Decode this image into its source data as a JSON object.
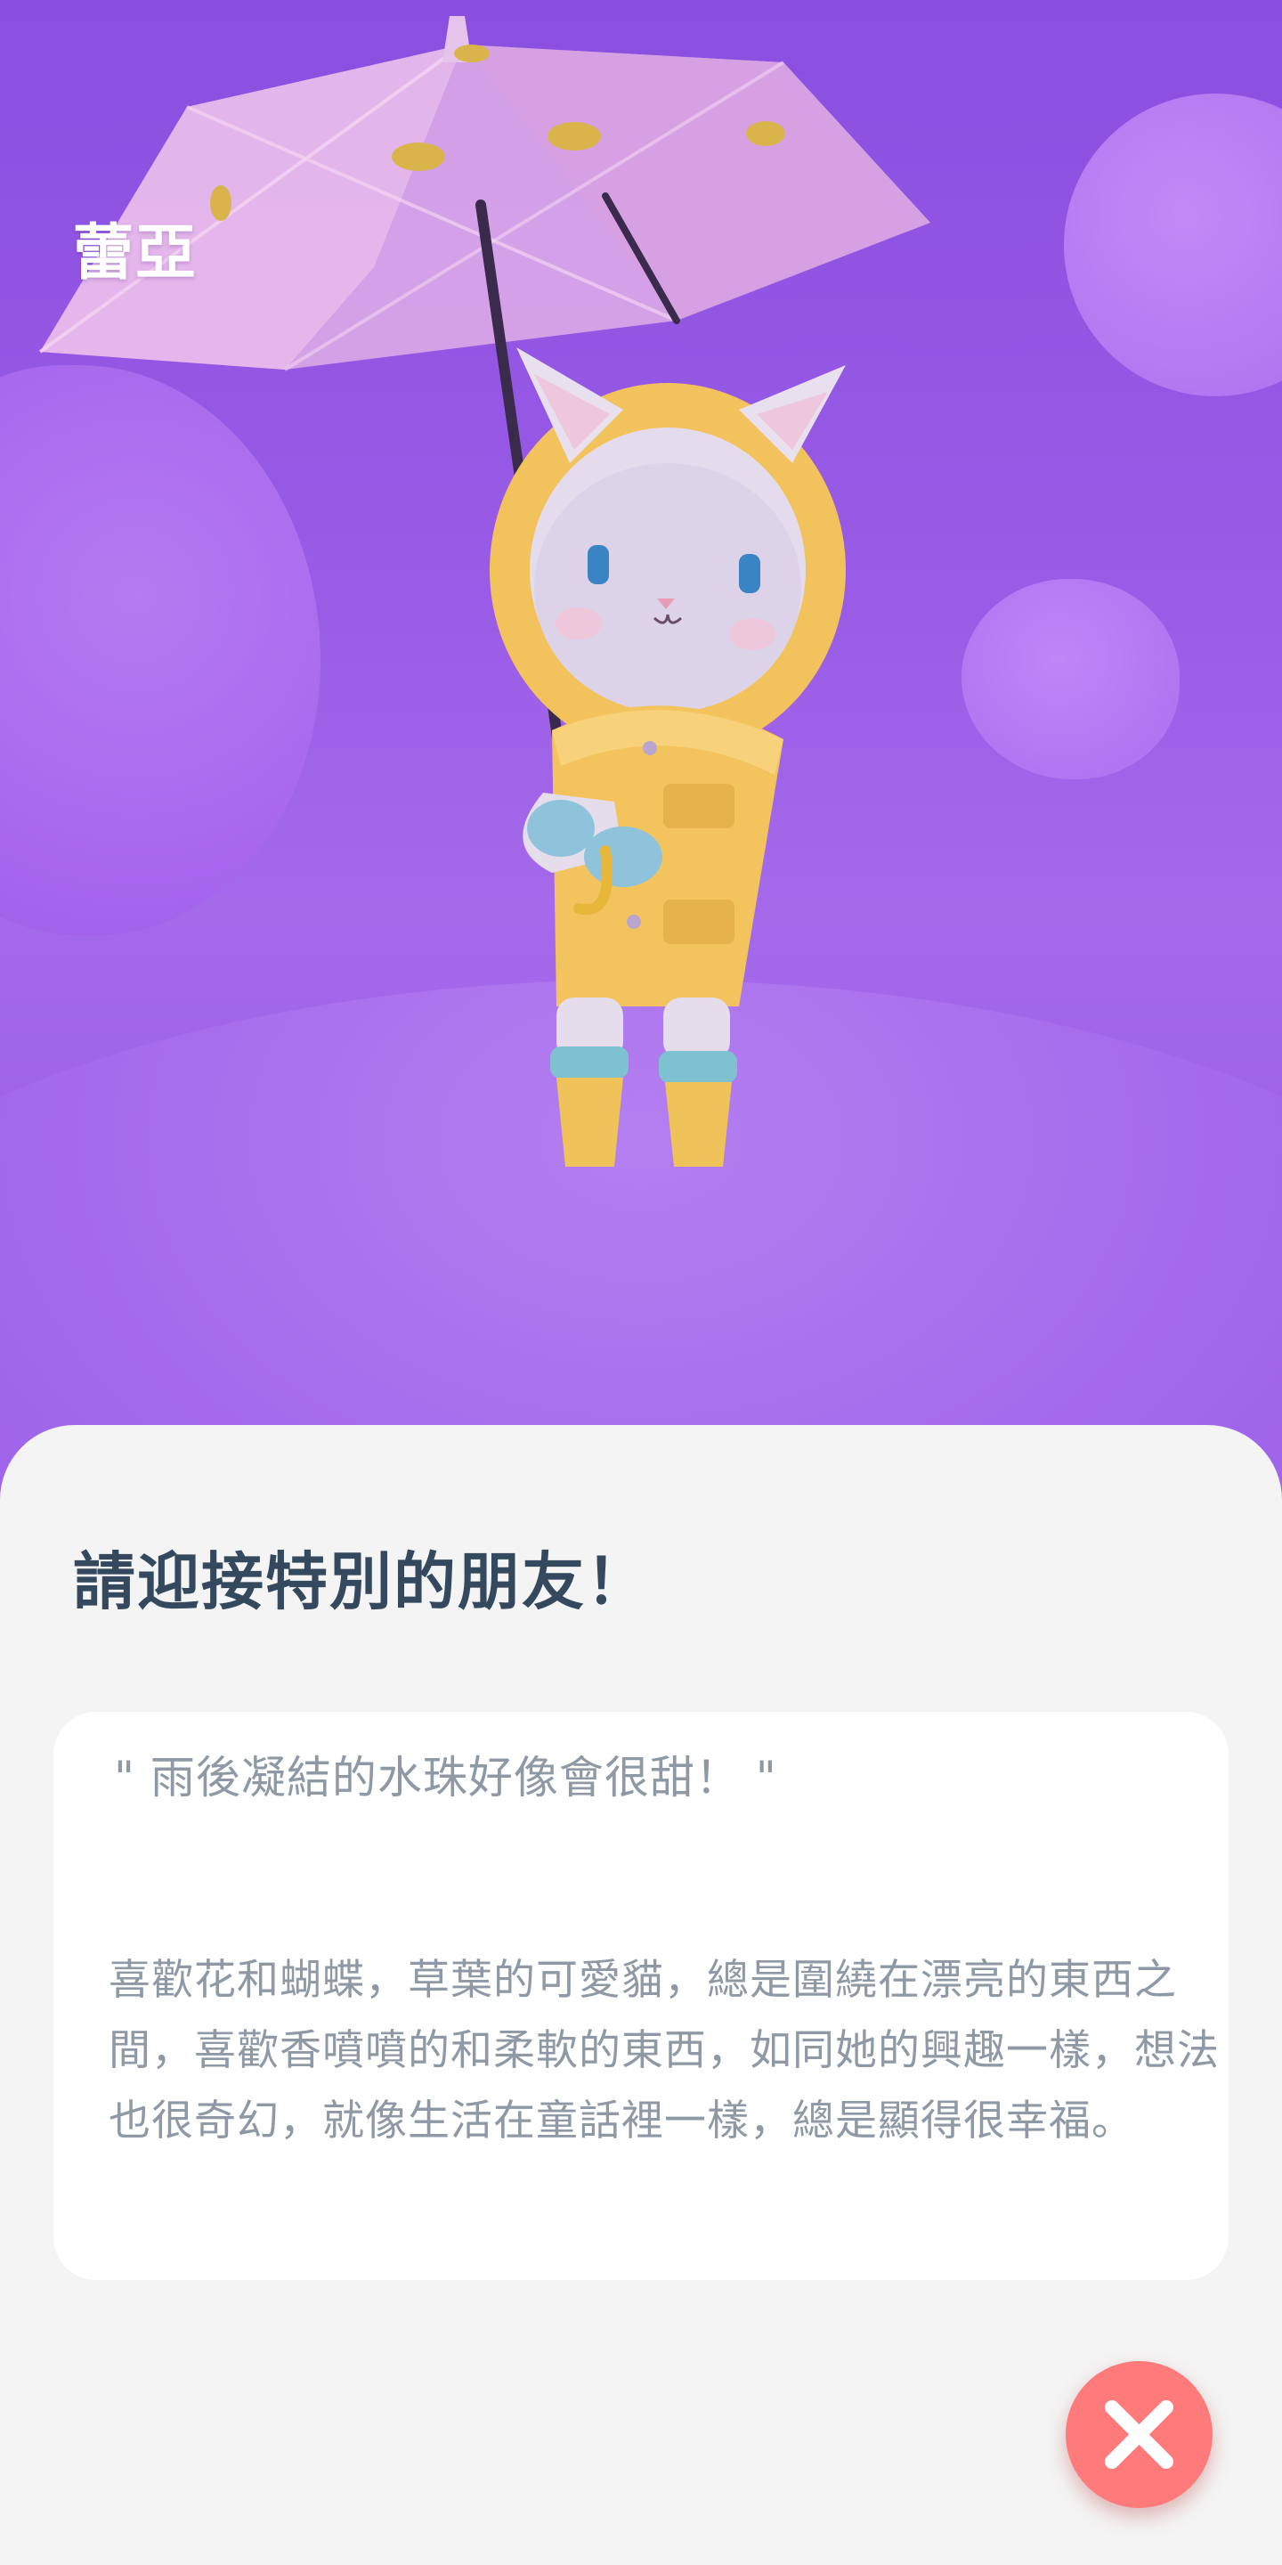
{
  "character": {
    "name": "蕾亞"
  },
  "sheet": {
    "title": "請迎接特別的朋友！",
    "quote": "\" 雨後凝結的水珠好像會很甜！ \"",
    "description": "喜歡花和蝴蝶，草葉的可愛貓，總是圍繞在漂亮的東西之間，喜歡香噴噴的和柔軟的東西，如同她的興趣一樣，想法也很奇幻，就像生活在童話裡一樣，總是顯得很幸福。"
  },
  "close_button": {
    "icon": "close-icon"
  },
  "colors": {
    "background_purple": "#9a5ce6",
    "sheet_background": "#f4f4f4",
    "title_text": "#34495e",
    "body_text": "#8e99a5",
    "close_button": "#ff7b7b"
  }
}
